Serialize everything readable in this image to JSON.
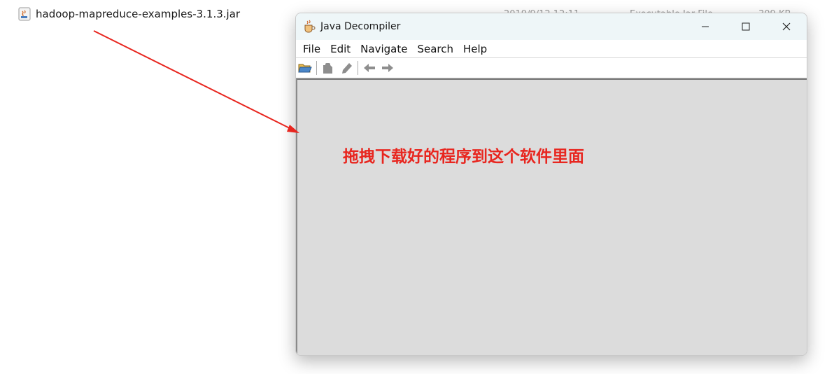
{
  "explorer": {
    "file_name": "hadoop-mapreduce-examples-3.1.3.jar",
    "date": "2019/9/12 12:11",
    "type": "Executable Jar File",
    "size": "309 KB"
  },
  "window": {
    "title": "Java Decompiler",
    "controls": {
      "minimize_icon": "minimize-icon",
      "maximize_icon": "maximize-icon",
      "close_icon": "close-icon"
    }
  },
  "menu": [
    "File",
    "Edit",
    "Navigate",
    "Search",
    "Help"
  ],
  "toolbar": {
    "icons": [
      "open-folder-icon",
      "clipboard-icon",
      "pencil-icon",
      "back-arrow-icon",
      "forward-arrow-icon"
    ]
  },
  "annotation": {
    "text": "拖拽下载好的程序到这个软件里面",
    "color": "#e8261f"
  }
}
